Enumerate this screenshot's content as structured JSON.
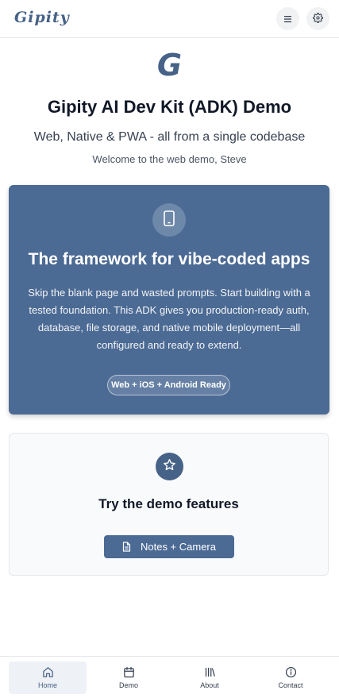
{
  "header": {
    "logo_text": "Gipity",
    "menu_icon": "menu-icon",
    "settings_icon": "gear-icon"
  },
  "hero": {
    "logo_letter": "G",
    "title": "Gipity AI Dev Kit (ADK) Demo",
    "subtitle": "Web, Native & PWA - all from a single codebase",
    "welcome": "Welcome to the web demo, Steve"
  },
  "feature_card": {
    "icon": "mobile-phone-icon",
    "title": "The framework for vibe-coded apps",
    "description": "Skip the blank page and wasted prompts. Start building with a tested foundation. This ADK gives you production-ready auth, database, file storage, and native mobile deployment—all configured and ready to extend.",
    "badge": "Web + iOS + Android Ready"
  },
  "demo_card": {
    "icon": "star-icon",
    "title": "Try the demo features",
    "button_label": "Notes + Camera",
    "button_icon": "document-icon"
  },
  "bottom_nav": {
    "items": [
      {
        "label": "Home",
        "icon": "home-icon",
        "active": true
      },
      {
        "label": "Demo",
        "icon": "calendar-icon",
        "active": false
      },
      {
        "label": "About",
        "icon": "library-icon",
        "active": false
      },
      {
        "label": "Contact",
        "icon": "info-icon",
        "active": false
      }
    ]
  },
  "colors": {
    "brand": "#466287",
    "card_blue": "#4b6a94",
    "text_dark": "#111827"
  }
}
